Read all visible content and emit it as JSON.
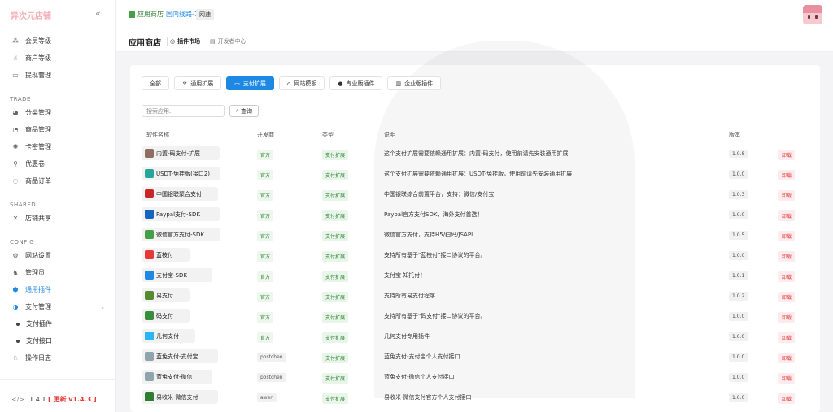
{
  "brand": "异次元店铺",
  "sidebar": {
    "items_top": [
      {
        "label": "会员等级",
        "icon": "cluster-icon"
      },
      {
        "label": "商户等级",
        "icon": "pointer-icon"
      },
      {
        "label": "提现管理",
        "icon": "wallet-icon"
      }
    ],
    "section_trade": "TRADE",
    "items_trade": [
      {
        "label": "分类管理",
        "icon": "category-icon"
      },
      {
        "label": "商品管理",
        "icon": "goods-icon"
      },
      {
        "label": "卡密管理",
        "icon": "key-icon"
      },
      {
        "label": "优惠卷",
        "icon": "coupon-icon"
      },
      {
        "label": "商品订单",
        "icon": "order-icon"
      }
    ],
    "section_shared": "SHARED",
    "items_shared": [
      {
        "label": "店铺共享",
        "icon": "share-icon"
      }
    ],
    "section_config": "CONFIG",
    "items_config": [
      {
        "label": "网站设置",
        "icon": "settings-icon"
      },
      {
        "label": "管理员",
        "icon": "admin-icon"
      },
      {
        "label": "通用插件",
        "icon": "plugin-icon"
      },
      {
        "label": "支付管理",
        "icon": "payment-icon"
      },
      {
        "label": "支付插件"
      },
      {
        "label": "支付接口"
      },
      {
        "label": "操作日志",
        "icon": "log-icon"
      }
    ],
    "version": "1.4.1",
    "update": "[ 更新 v1.4.3 ]"
  },
  "topbar": {
    "store": "应用商店",
    "line": "国内线路-1",
    "net_badge": "网速"
  },
  "subbar": {
    "title": "应用商店",
    "tab_market": "插件市场",
    "tab_dev": "开发者中心"
  },
  "filters": [
    {
      "label": "全部",
      "active": false
    },
    {
      "label": "通用扩展",
      "active": false
    },
    {
      "label": "支付扩展",
      "active": true
    },
    {
      "label": "网站模板",
      "active": false
    },
    {
      "label": "专业版插件",
      "active": false
    },
    {
      "label": "企业版插件",
      "active": false
    }
  ],
  "search": {
    "placeholder": "搜索应用..",
    "button": "查询"
  },
  "table": {
    "headers": [
      "软件名称",
      "开发商",
      "类型",
      "说明",
      "版本"
    ],
    "rows": [
      {
        "name": "内置-码支付-扩展",
        "dev": "官方",
        "type": "支付扩展",
        "desc": "这个支付扩展需要依赖通用扩展：内置-码支付，使用前请先安装通用扩展",
        "ver": "1.0.8",
        "action": "卸载",
        "color": "#8d6e63"
      },
      {
        "name": "USDT-免挂版(接口2)",
        "dev": "官方",
        "type": "支付扩展",
        "desc": "这个支付扩展需要依赖通用扩展：USDT-免挂版，使用前请先安装通用扩展",
        "ver": "1.0.0",
        "action": "卸载",
        "color": "#26a69a"
      },
      {
        "name": "中国银联聚合支付",
        "dev": "官方",
        "type": "支付扩展",
        "desc": "中国银联综合前置平台，支持：微信/支付宝",
        "ver": "1.0.3",
        "action": "卸载",
        "color": "#c62828"
      },
      {
        "name": "Paypal支付-SDK",
        "dev": "官方",
        "type": "支付扩展",
        "desc": "Paypal官方支付SDK，海外支付首选！",
        "ver": "1.0.0",
        "action": "卸载",
        "color": "#1565c0"
      },
      {
        "name": "微信官方支付-SDK",
        "dev": "官方",
        "type": "支付扩展",
        "desc": "微信官方支付，支持H5/扫码/JSAPI",
        "ver": "1.0.5",
        "action": "卸载",
        "color": "#43a047"
      },
      {
        "name": "蓝枝付",
        "dev": "官方",
        "type": "支付扩展",
        "desc": "支持所有基于\"蓝枝付\"接口协议的平台。",
        "ver": "1.0.0",
        "action": "卸载",
        "color": "#e53935"
      },
      {
        "name": "支付宝-SDK",
        "dev": "官方",
        "type": "支付扩展",
        "desc": "支付宝 知托付！",
        "ver": "1.0.1",
        "action": "卸载",
        "color": "#1e88e5"
      },
      {
        "name": "易支付",
        "dev": "官方",
        "type": "支付扩展",
        "desc": "支持所有易支付程序",
        "ver": "1.0.2",
        "action": "卸载",
        "color": "#558b2f"
      },
      {
        "name": "码支付",
        "dev": "官方",
        "type": "支付扩展",
        "desc": "支持所有基于\"码支付\"接口协议的平台。",
        "ver": "1.0.0",
        "action": "卸载",
        "color": "#388e3c"
      },
      {
        "name": "几何支付",
        "dev": "官方",
        "type": "支付扩展",
        "desc": "几何支付专用插件",
        "ver": "1.0.0",
        "action": "卸载",
        "color": "#29b6f6"
      },
      {
        "name": "蓝兔支付-支付宝",
        "dev": "postchen",
        "type": "支付扩展",
        "desc": "蓝兔支付-支付宝个人支付接口",
        "ver": "1.0.0",
        "action": "卸载",
        "color": "#90a4ae"
      },
      {
        "name": "蓝兔支付-微信",
        "dev": "postchen",
        "type": "支付扩展",
        "desc": "蓝兔支付-微信个人支付接口",
        "ver": "1.0.0",
        "action": "卸载",
        "color": "#90a4ae"
      },
      {
        "name": "易收米-微信支付",
        "dev": "awen",
        "type": "支付扩展",
        "desc": "易收米-微信支付官方个人支付接口",
        "ver": "1.0.0",
        "action": "卸载",
        "color": "#2e7d32"
      }
    ]
  }
}
